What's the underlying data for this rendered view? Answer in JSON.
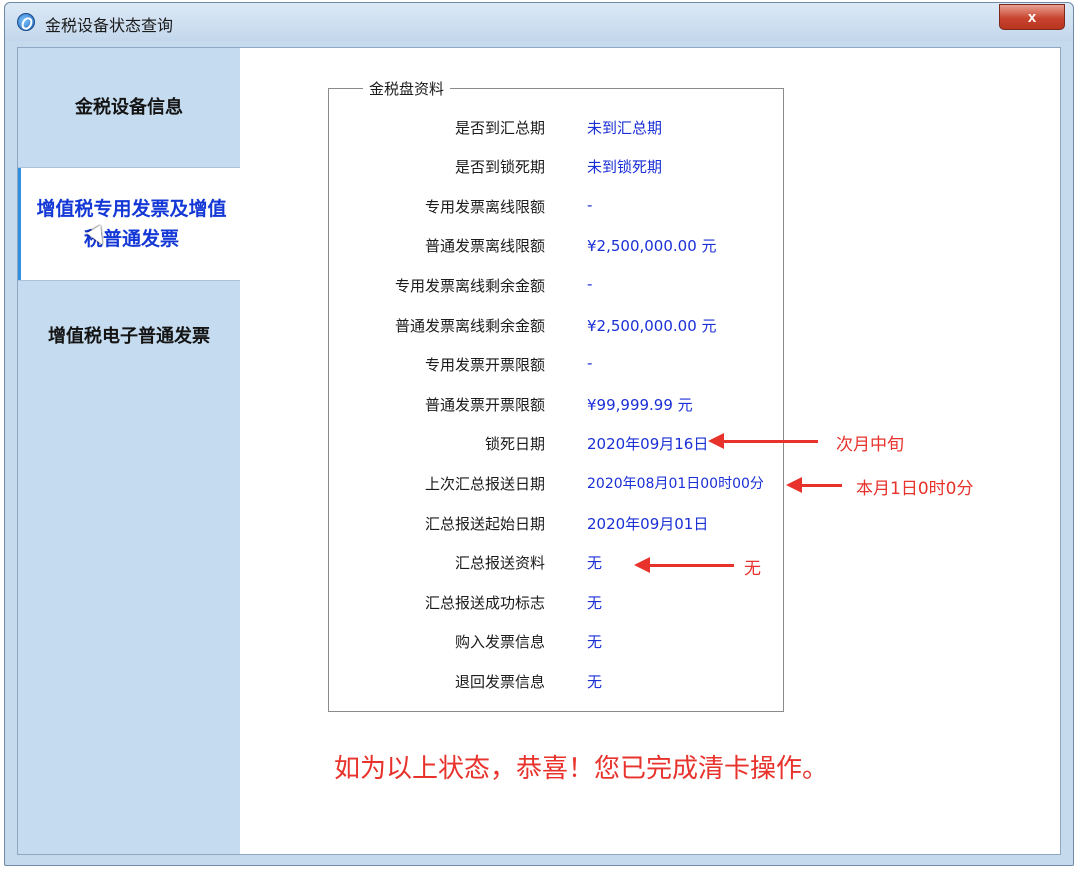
{
  "window": {
    "title": "金税设备状态查询",
    "close_label": "x"
  },
  "sidebar": {
    "items": [
      {
        "label": "金税设备信息"
      },
      {
        "label": "增值税专用发票及增值税普通发票"
      },
      {
        "label": "增值税电子普通发票"
      }
    ]
  },
  "panel": {
    "legend": "金税盘资料",
    "rows": [
      {
        "label": "是否到汇总期",
        "value": "未到汇总期"
      },
      {
        "label": "是否到锁死期",
        "value": "未到锁死期"
      },
      {
        "label": "专用发票离线限额",
        "value": "-"
      },
      {
        "label": "普通发票离线限额",
        "value": "¥2,500,000.00 元"
      },
      {
        "label": "专用发票离线剩余金额",
        "value": "-"
      },
      {
        "label": "普通发票离线剩余金额",
        "value": "¥2,500,000.00 元"
      },
      {
        "label": "专用发票开票限额",
        "value": "-"
      },
      {
        "label": "普通发票开票限额",
        "value": "¥99,999.99 元"
      },
      {
        "label": "锁死日期",
        "value": "2020年09月16日"
      },
      {
        "label": "上次汇总报送日期",
        "value": "2020年08月01日00时00分"
      },
      {
        "label": "汇总报送起始日期",
        "value": "2020年09月01日"
      },
      {
        "label": "汇总报送资料",
        "value": "无"
      },
      {
        "label": "汇总报送成功标志",
        "value": "无"
      },
      {
        "label": "购入发票信息",
        "value": "无"
      },
      {
        "label": "退回发票信息",
        "value": "无"
      }
    ]
  },
  "annotations": {
    "lock_date_note": "次月中旬",
    "last_report_note": "本月1日0时0分",
    "report_data_note": "无",
    "congrats": "如为以上状态，恭喜！您已完成清卡操作。"
  },
  "colors": {
    "value_text": "#1a2fd6",
    "annotation": "#e8322c",
    "sidebar_bg": "#c5dbef",
    "active_nav_text": "#1438d6"
  }
}
